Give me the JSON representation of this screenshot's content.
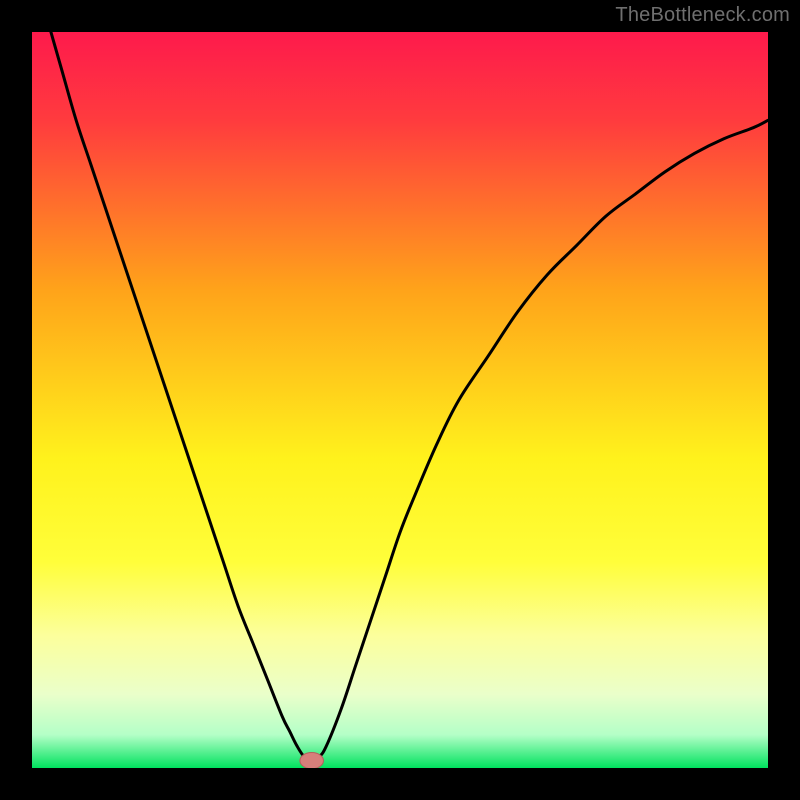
{
  "attribution": "TheBottleneck.com",
  "colors": {
    "frame": "#000000",
    "gradient_top": "#fe1a4c",
    "gradient_mid_upper": "#ffa31a",
    "gradient_mid": "#fffc1c",
    "gradient_low": "#fcff9c",
    "gradient_bottom": "#00e25e",
    "curve": "#000000",
    "marker_fill": "#d77f7b",
    "marker_stroke": "#b4605d"
  },
  "chart_data": {
    "type": "line",
    "title": "",
    "xlabel": "",
    "ylabel": "",
    "xlim": [
      0,
      100
    ],
    "ylim": [
      0,
      100
    ],
    "series": [
      {
        "name": "bottleneck-curve",
        "x": [
          0,
          2,
          4,
          6,
          8,
          10,
          12,
          14,
          16,
          18,
          20,
          22,
          24,
          26,
          28,
          30,
          32,
          34,
          35,
          36,
          37,
          38,
          39,
          40,
          42,
          44,
          46,
          48,
          50,
          52,
          55,
          58,
          62,
          66,
          70,
          74,
          78,
          82,
          86,
          90,
          94,
          98,
          100
        ],
        "y": [
          109,
          102,
          95,
          88,
          82,
          76,
          70,
          64,
          58,
          52,
          46,
          40,
          34,
          28,
          22,
          17,
          12,
          7,
          5,
          3,
          1.5,
          1,
          1.5,
          3,
          8,
          14,
          20,
          26,
          32,
          37,
          44,
          50,
          56,
          62,
          67,
          71,
          75,
          78,
          81,
          83.5,
          85.5,
          87,
          88
        ]
      }
    ],
    "marker": {
      "x": 38,
      "y": 1,
      "rx": 1.6,
      "ry": 1.1
    },
    "gradient_stops": [
      {
        "offset": 0.0,
        "color": "#fe1a4c"
      },
      {
        "offset": 0.12,
        "color": "#ff3b3e"
      },
      {
        "offset": 0.35,
        "color": "#ffa31a"
      },
      {
        "offset": 0.58,
        "color": "#fff21c"
      },
      {
        "offset": 0.72,
        "color": "#fffe3a"
      },
      {
        "offset": 0.82,
        "color": "#fcff9c"
      },
      {
        "offset": 0.9,
        "color": "#eaffca"
      },
      {
        "offset": 0.955,
        "color": "#b4ffc7"
      },
      {
        "offset": 1.0,
        "color": "#00e25e"
      }
    ]
  }
}
